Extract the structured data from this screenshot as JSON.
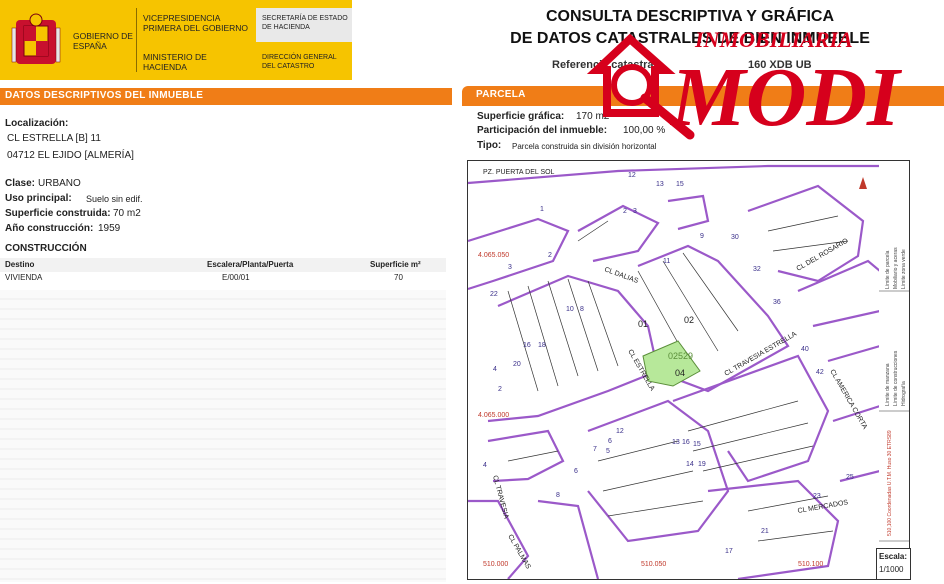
{
  "header": {
    "gov_title": "GOBIERNO DE ESPAÑA",
    "vicepresidencia": "VICEPRESIDENCIA PRIMERA DEL GOBIERNO",
    "ministerio": "MINISTERIO DE HACIENDA",
    "secretaria": "SECRETARÍA DE ESTADO DE HACIENDA",
    "direccion": "DIRECCIÓN GENERAL DEL CATASTRO",
    "title_line1": "CONSULTA DESCRIPTIVA Y GRÁFICA",
    "title_line2": "DE DATOS CATASTRALES DE BIEN INMUEBLE",
    "referencia_label": "Referencia catastral:",
    "referencia_tail": "160 XDB UB"
  },
  "left": {
    "section_title": "DATOS DESCRIPTIVOS DEL INMUEBLE",
    "localizacion_label": "Localización:",
    "address_line1": "CL ESTRELLA [B] 11",
    "address_line2": "04712 EL EJIDO [ALMERÍA]",
    "clase_label": "Clase:",
    "clase_value": "URBANO",
    "uso_label": "Uso principal:",
    "uso_value": "Suelo sin edif.",
    "sup_label": "Superficie construida:",
    "sup_value": "70 m2",
    "anio_label": "Año construcción:",
    "anio_value": "1959",
    "construccion_title": "CONSTRUCCIÓN",
    "table_headers": [
      "Destino",
      "Escalera/Planta/Puerta",
      "Superficie m²"
    ],
    "table_rows": [
      [
        "VIVIENDA",
        "E/00/01",
        "70"
      ]
    ]
  },
  "right": {
    "section_title": "PARCELA",
    "sup_grafica_label": "Superficie gráfica:",
    "sup_grafica_value": "170 m2",
    "participacion_label": "Participación del inmueble:",
    "participacion_value": "100,00 %",
    "tipo_label": "Tipo:",
    "tipo_value": "Parcela construida sin división horizontal"
  },
  "map": {
    "street_labels": [
      "PZ. PUERTA DEL SOL",
      "CL DALIAS",
      "CL DEL ROSARIO",
      "CL TRAVESIA ESTRELLA",
      "CL ESTRELLA",
      "CL AMERICA CORTA",
      "CL TRAVESIA",
      "CL MERCADOS",
      "CL PALMAS"
    ],
    "coord_labels": [
      "4.065.050",
      "4.065.000",
      "510.050",
      "510.000",
      "510.100"
    ],
    "parcel_labels": [
      "01",
      "02",
      "04",
      "02529"
    ],
    "numbers": [
      "12",
      "13",
      "15",
      "2",
      "3",
      "9",
      "11",
      "30",
      "32",
      "36",
      "40",
      "42",
      "25",
      "23",
      "21",
      "17",
      "19",
      "14",
      "15",
      "16",
      "13",
      "12",
      "7",
      "5",
      "6",
      "8",
      "4",
      "3",
      "2",
      "1",
      "10",
      "16",
      "18",
      "20",
      "22",
      "8",
      "4",
      "2",
      "6"
    ],
    "legend_items": [
      "Límite de manzana",
      "Límite de parcela",
      "Límite de construcciones",
      "Mobiliario y aceras",
      "Límite zona verde",
      "Hidrografía"
    ],
    "projection": "510,100 Coordenadas U.T.M. Huso 30 ETRS89",
    "scale_label": "Escala:",
    "scale_value": "1/1000"
  },
  "watermark": {
    "top": "INMOBILIARIA",
    "main": "MODI"
  },
  "colors": {
    "orange": "#f07d17",
    "gov_yellow": "#f6c400",
    "parcel_purple": "#9b59c9",
    "selected_parcel": "#b7e89a",
    "watermark_red": "#d6001c"
  }
}
